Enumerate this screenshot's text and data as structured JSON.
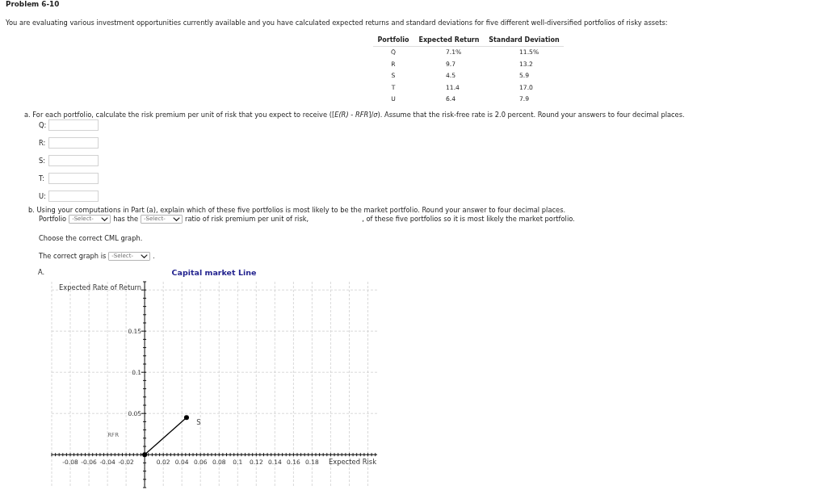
{
  "problem": {
    "title": "Problem 6-10",
    "intro": "You are evaluating various investment opportunities currently available and you have calculated expected returns and standard deviations for five different well-diversified portfolios of risky assets:"
  },
  "table": {
    "columns": [
      "Portfolio",
      "Expected Return",
      "Standard Deviation"
    ],
    "rows": [
      [
        "Q",
        "7.1%",
        "11.5%"
      ],
      [
        "R",
        "9.7",
        "13.2"
      ],
      [
        "S",
        "4.5",
        "5.9"
      ],
      [
        "T",
        "11.4",
        "17.0"
      ],
      [
        "U",
        "6.4",
        "7.9"
      ]
    ]
  },
  "part_a": {
    "prompt": "a. For each portfolio, calculate the risk premium per unit of risk that you expect to receive ([*E(R)* - *RFR*]/*σ*). Assume that the risk-free rate is 2.0 percent. Round your answers to four decimal places.",
    "answers": [
      {
        "label": "Q:"
      },
      {
        "label": "R:"
      },
      {
        "label": "S:"
      },
      {
        "label": "T:"
      },
      {
        "label": "U:"
      }
    ]
  },
  "part_b": {
    "prompt": "b. Using your computations in Part (a), explain which of these five portfolios is most likely to be the market portfolio. Round your answer to four decimal places.",
    "sentence": [
      {
        "kind": "text",
        "text": "Portfolio"
      },
      {
        "kind": "select",
        "value": "-Select-"
      },
      {
        "kind": "text",
        "text": "has the"
      },
      {
        "kind": "select",
        "value": "-Select-"
      },
      {
        "kind": "text",
        "text": "ratio of risk premium per unit of risk,"
      },
      {
        "kind": "blank"
      },
      {
        "kind": "text",
        "text": ", of these five portfolios so it is most likely the market portfolio."
      }
    ]
  },
  "graph_question": {
    "instruction": "Choose the correct CML graph.",
    "sentence": [
      {
        "kind": "text",
        "text": "The correct graph is"
      },
      {
        "kind": "select",
        "value": "-Select-"
      },
      {
        "kind": "text",
        "text": "."
      }
    ],
    "options": [
      {
        "label": "A.",
        "chart_data": {
          "type": "line",
          "title": "Capital market Line",
          "xlabel": "Expected Risk",
          "ylabel": "Expected Rate of Return",
          "x": [
            0,
            0.045
          ],
          "values": [
            0,
            0.045
          ],
          "color": "#000000",
          "marker": "circle",
          "xlim": [
            -0.1,
            0.25
          ],
          "ylim": [
            -0.04,
            0.21
          ],
          "xticks": [
            -0.08,
            -0.06,
            -0.04,
            -0.02,
            0.02,
            0.04,
            0.06,
            0.08,
            0.1,
            0.12,
            0.14,
            0.16,
            0.18
          ],
          "yticks": [
            0.05,
            0.1,
            0.15
          ],
          "grid": true,
          "annotations": [
            "RFR",
            "S"
          ]
        }
      }
    ]
  }
}
